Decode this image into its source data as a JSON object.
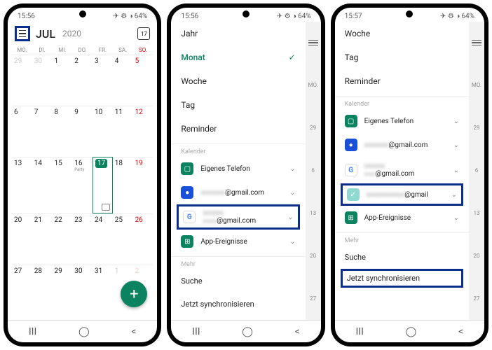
{
  "statusbar": {
    "time1": "15:56",
    "time2": "15:56",
    "time3": "15:57",
    "battery": "64%"
  },
  "phone1": {
    "month": "JUL",
    "year": "2020",
    "today_icon": "17",
    "weekdays": [
      "MO.",
      "DI.",
      "MI.",
      "DO.",
      "FR.",
      "SA.",
      "SO."
    ],
    "prev": [
      "29",
      "30"
    ],
    "days": [
      "1",
      "2",
      "3",
      "4",
      "5",
      "6",
      "7",
      "8",
      "9",
      "10",
      "11",
      "12",
      "13",
      "14",
      "15",
      "16",
      "17",
      "18",
      "19",
      "20",
      "21",
      "22",
      "23",
      "24",
      "25",
      "26",
      "27",
      "28",
      "29",
      "30",
      "31"
    ],
    "next": [
      "1",
      "2"
    ],
    "event_day": "16",
    "event_label": "Party",
    "today": "17"
  },
  "drawer": {
    "views": {
      "jahr": "Jahr",
      "monat": "Monat",
      "woche": "Woche",
      "tag": "Tag",
      "reminder": "Reminder"
    },
    "section_kalender": "Kalender",
    "cal_phone": "Eigenes Telefon",
    "cal_gmail1_suffix": "@gmail.com",
    "cal_gmail2_suffix": "@gmail.com",
    "cal_gmail3_suffix": "@gmail",
    "cal_apps": "App-Ereignisse",
    "section_mehr": "Mehr",
    "suche": "Suche",
    "sync": "Jetzt synchronisieren"
  },
  "strip": {
    "mo": "MO.",
    "d6": "6",
    "d13": "13",
    "d20": "20",
    "d27": "27",
    "d29": "29"
  },
  "nav": {
    "recent": "III",
    "home": "◯",
    "back": "<"
  }
}
